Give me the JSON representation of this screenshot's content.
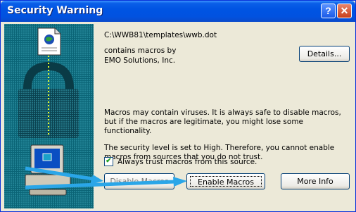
{
  "window": {
    "title": "Security Warning",
    "help_glyph": "?",
    "close_glyph": "✕"
  },
  "info": {
    "file_path": "C:\\WWB81\\templates\\wwb.dot",
    "contains_text": "contains macros by",
    "publisher": "EMO Solutions, Inc."
  },
  "buttons": {
    "details": "Details...",
    "disable_macros": "Disable Macros",
    "enable_macros": "Enable Macros",
    "more_info": "More Info"
  },
  "messages": {
    "virus_warning": "Macros may contain viruses. It is always safe to disable macros, but if the macros are legitimate, you might lose some functionality.",
    "security_level": "The security level is set to High.  Therefore, you cannot enable macros from sources that you do not trust."
  },
  "trust_checkbox": {
    "label": "Always trust macros from this source.",
    "checked": true
  },
  "colors": {
    "titlebar": "#0054e3",
    "dialog_bg": "#ece9d8",
    "side_art_bg": "#0e6f82",
    "annotation_arrow": "#2aa6e8"
  },
  "icons": [
    "document-icon",
    "lock-icon",
    "computer-icon",
    "help-icon",
    "close-icon",
    "annotation-arrow"
  ]
}
